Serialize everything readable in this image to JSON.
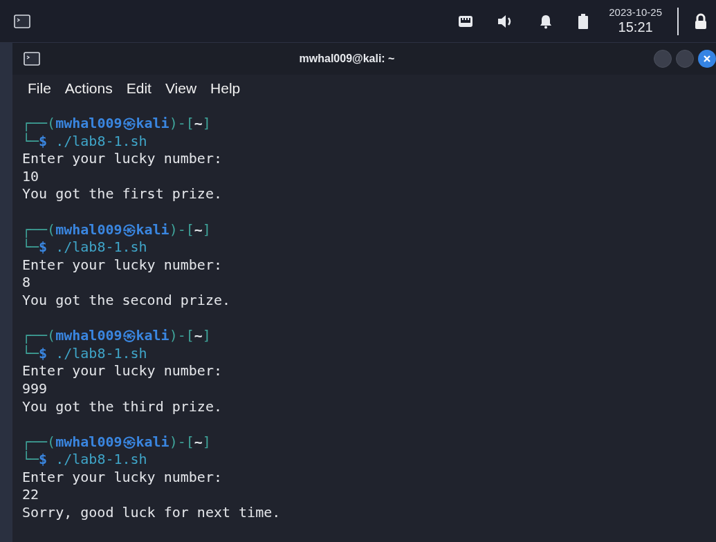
{
  "taskbar": {
    "date": "2023-10-25",
    "time": "15:21"
  },
  "window": {
    "title": "mwhal009@kali: ~"
  },
  "menu": [
    "File",
    "Actions",
    "Edit",
    "View",
    "Help"
  ],
  "sessions": [
    {
      "lead": "┌──(",
      "user": "mwhal009",
      "at": "㉿",
      "host": "kali",
      "mid": ")-[",
      "dir": "~",
      "close": "]",
      "cmd_lead": "└─",
      "dollar": "$",
      "command": "./lab8-1.sh",
      "output": [
        "Enter your lucky number:",
        "10",
        "You got the first prize."
      ]
    },
    {
      "lead": "┌──(",
      "user": "mwhal009",
      "at": "㉿",
      "host": "kali",
      "mid": ")-[",
      "dir": "~",
      "close": "]",
      "cmd_lead": "└─",
      "dollar": "$",
      "command": "./lab8-1.sh",
      "output": [
        "Enter your lucky number:",
        "8",
        "You got the second prize."
      ]
    },
    {
      "lead": "┌──(",
      "user": "mwhal009",
      "at": "㉿",
      "host": "kali",
      "mid": ")-[",
      "dir": "~",
      "close": "]",
      "cmd_lead": "└─",
      "dollar": "$",
      "command": "./lab8-1.sh",
      "output": [
        "Enter your lucky number:",
        "999",
        "You got the third prize."
      ]
    },
    {
      "lead": "┌──(",
      "user": "mwhal009",
      "at": "㉿",
      "host": "kali",
      "mid": ")-[",
      "dir": "~",
      "close": "]",
      "cmd_lead": "└─",
      "dollar": "$",
      "command": "./lab8-1.sh",
      "output": [
        "Enter your lucky number:",
        "22",
        "Sorry, good luck for next time."
      ]
    }
  ]
}
